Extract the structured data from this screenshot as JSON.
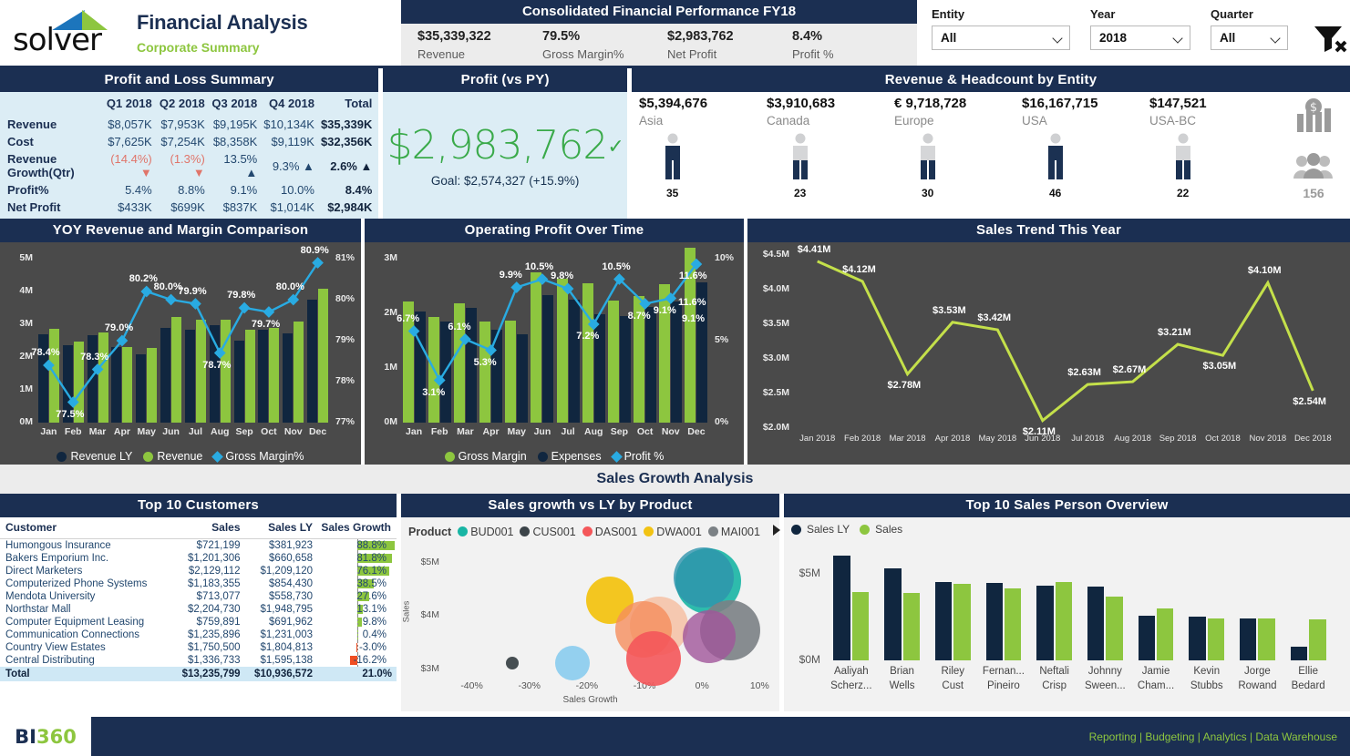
{
  "brand": {
    "logo_text": "solver",
    "title": "Financial Analysis",
    "subtitle": "Corporate Summary"
  },
  "header_kpi": {
    "title": "Consolidated Financial Performance FY18",
    "items": [
      {
        "value": "$35,339,322",
        "label": "Revenue"
      },
      {
        "value": "79.5%",
        "label": "Gross Margin%"
      },
      {
        "value": "$2,983,762",
        "label": "Net Profit"
      },
      {
        "value": "8.4%",
        "label": "Profit %"
      }
    ]
  },
  "filters": [
    {
      "label": "Entity",
      "value": "All"
    },
    {
      "label": "Year",
      "value": "2018"
    },
    {
      "label": "Quarter",
      "value": "All"
    }
  ],
  "filter_clear_icon": "clear-filter-icon",
  "pl": {
    "title": "Profit and Loss Summary",
    "columns": [
      "",
      "Q1 2018",
      "Q2 2018",
      "Q3 2018",
      "Q4 2018",
      "Total"
    ],
    "rows": [
      {
        "label": "Revenue",
        "cells": [
          "$8,057K",
          "$7,953K",
          "$9,195K",
          "$10,134K",
          "$35,339K"
        ]
      },
      {
        "label": "Cost",
        "cells": [
          "$7,625K",
          "$7,254K",
          "$8,358K",
          "$9,119K",
          "$32,356K"
        ]
      },
      {
        "label": "Revenue Growth(Qtr)",
        "cells": [
          "(14.4%)",
          "(1.3%)",
          "13.5%",
          "9.3%",
          "2.6%"
        ],
        "dirs": [
          "down",
          "down",
          "up",
          "up",
          "up"
        ]
      },
      {
        "label": "Profit%",
        "cells": [
          "5.4%",
          "8.8%",
          "9.1%",
          "10.0%",
          "8.4%"
        ]
      },
      {
        "label": "Net Profit",
        "cells": [
          "$433K",
          "$699K",
          "$837K",
          "$1,014K",
          "$2,984K"
        ]
      }
    ]
  },
  "profit_card": {
    "title": "Profit (vs PY)",
    "value": "$2,983,762",
    "check": "✓",
    "goal": "Goal: $2,574,327 (+15.9%)"
  },
  "entity_panel": {
    "title": "Revenue & Headcount by Entity",
    "entities": [
      {
        "revenue": "$5,394,676",
        "name": "Asia",
        "headcount": "35",
        "fill": "dark"
      },
      {
        "revenue": "$3,910,683",
        "name": "Canada",
        "headcount": "23",
        "fill": "light"
      },
      {
        "revenue": "€ 9,718,728",
        "name": "Europe",
        "headcount": "30",
        "fill": "half"
      },
      {
        "revenue": "$16,167,715",
        "name": "USA",
        "headcount": "46",
        "fill": "dark"
      },
      {
        "revenue": "$147,521",
        "name": "USA-BC",
        "headcount": "22",
        "fill": "light"
      }
    ],
    "money_icon": "money-bars-icon",
    "people_icon": "people-group-icon",
    "total_headcount": "156"
  },
  "chart_data": [
    {
      "id": "yoy",
      "type": "bar",
      "title": "YOY Revenue and Margin Comparison",
      "categories": [
        "Jan",
        "Feb",
        "Mar",
        "Apr",
        "May",
        "Jun",
        "Jul",
        "Aug",
        "Sep",
        "Oct",
        "Nov",
        "Dec"
      ],
      "series": [
        {
          "name": "Revenue LY",
          "color": "#10263f",
          "values": [
            2.7,
            2.37,
            2.66,
            2.3,
            2.08,
            2.9,
            2.83,
            2.97,
            2.51,
            2.82,
            2.72,
            3.75
          ]
        },
        {
          "name": "Revenue",
          "color": "#8dc63f",
          "values": [
            2.85,
            2.46,
            2.74,
            2.3,
            2.28,
            3.22,
            3.15,
            3.13,
            2.82,
            2.88,
            3.09,
            4.07
          ]
        }
      ],
      "line": {
        "name": "Gross Margin%",
        "color": "#29abe2",
        "values": [
          78.4,
          77.5,
          78.3,
          79.0,
          80.2,
          80.0,
          79.9,
          78.7,
          79.8,
          79.7,
          80.0,
          80.9
        ],
        "labels": [
          "78.4%",
          "77.5%",
          "78.3%",
          "79.0%",
          "80.2%",
          "80.0%",
          "79.9%",
          "78.7%",
          "79.8%",
          "79.7%",
          "80.0%",
          "80.9%"
        ]
      },
      "ylabel_ticks": [
        "5M",
        "4M",
        "3M",
        "2M",
        "1M",
        "0M"
      ],
      "ylim": [
        0,
        5
      ],
      "y2_ticks": [
        "81%",
        "80%",
        "79%",
        "78%",
        "77%"
      ],
      "y2lim": [
        77,
        81
      ],
      "legend": [
        "Revenue LY",
        "Revenue",
        "Gross Margin%"
      ],
      "legend_position": "bottom"
    },
    {
      "id": "opprofit",
      "type": "bar",
      "title": "Operating Profit Over Time",
      "categories": [
        "Jan",
        "Feb",
        "Mar",
        "Apr",
        "May",
        "Jun",
        "Jul",
        "Aug",
        "Sep",
        "Oct",
        "Nov",
        "Dec"
      ],
      "series": [
        {
          "name": "Gross Margin",
          "color": "#8dc63f",
          "values": [
            2.22,
            1.93,
            2.18,
            1.85,
            1.86,
            2.75,
            2.64,
            2.55,
            2.23,
            2.32,
            2.54,
            3.2
          ]
        },
        {
          "name": "Expenses",
          "color": "#10263f",
          "values": [
            2.03,
            1.85,
            2.1,
            1.7,
            1.61,
            2.33,
            2.25,
            1.98,
            1.95,
            2.11,
            2.22,
            2.57
          ]
        }
      ],
      "line": {
        "name": "Profit %",
        "color": "#29abe2",
        "values": [
          6.7,
          3.1,
          6.1,
          5.3,
          9.9,
          10.5,
          9.8,
          7.2,
          10.5,
          8.7,
          9.1,
          11.6
        ],
        "labels": [
          "6.7%",
          "3.1%",
          "6.1%",
          "5.3%",
          "9.9%",
          "10.5%",
          "9.8%",
          "7.2%",
          "10.5%",
          "8.7%",
          "9.1%",
          "11.6%"
        ]
      },
      "extra_labels": [
        "11.6%",
        "9.1%"
      ],
      "ylabel_ticks": [
        "3M",
        "2M",
        "1M",
        "0M"
      ],
      "ylim": [
        0,
        3
      ],
      "y2_ticks": [
        "10%",
        "5%",
        "0%"
      ],
      "y2lim": [
        0,
        12
      ],
      "legend": [
        "Gross Margin",
        "Expenses",
        "Profit %"
      ],
      "legend_position": "bottom"
    },
    {
      "id": "salestrend",
      "type": "line",
      "title": "Sales Trend This Year",
      "categories": [
        "Jan 2018",
        "Feb 2018",
        "Mar 2018",
        "Apr 2018",
        "May 2018",
        "Jun 2018",
        "Jul 2018",
        "Aug 2018",
        "Sep 2018",
        "Oct 2018",
        "Nov 2018",
        "Dec 2018"
      ],
      "values": [
        4.41,
        4.12,
        2.78,
        3.53,
        3.42,
        2.11,
        2.63,
        2.67,
        3.21,
        3.05,
        4.1,
        2.54
      ],
      "labels": [
        "$4.41M",
        "$4.12M",
        "$2.78M",
        "$3.53M",
        "$3.42M",
        "$2.11M",
        "$2.63M",
        "$2.67M",
        "$3.21M",
        "$3.05M",
        "$4.10M",
        "$2.54M"
      ],
      "color": "#c4e04a",
      "ylabel_ticks": [
        "$4.5M",
        "$4.0M",
        "$3.5M",
        "$3.0M",
        "$2.5M",
        "$2.0M"
      ],
      "ylim": [
        2.0,
        4.5
      ],
      "xlabel": "",
      "ylabel": ""
    },
    {
      "id": "scatter",
      "type": "scatter",
      "title": "Sales growth vs LY by Product",
      "legend_label": "Product",
      "legend": [
        {
          "name": "BUD001",
          "color": "#18b5a4"
        },
        {
          "name": "CUS001",
          "color": "#3c4449"
        },
        {
          "name": "DAS001",
          "color": "#f4575a"
        },
        {
          "name": "DWA001",
          "color": "#f2c314"
        },
        {
          "name": "MAI001",
          "color": "#7b8185"
        }
      ],
      "xlabel": "Sales Growth",
      "ylabel": "Sales",
      "xticks": [
        "-40%",
        "-30%",
        "-20%",
        "-10%",
        "0%",
        "10%"
      ],
      "yticks": [
        "$5M",
        "$4M",
        "$3M"
      ],
      "xlim": [
        -45,
        12
      ],
      "ylim": [
        2.9,
        5.2
      ],
      "points": [
        {
          "product": "CUS001",
          "x": -33.0,
          "y": 3.12,
          "r": 7,
          "color": "#3c4449",
          "opacity": 0.95
        },
        {
          "product": "P-blue",
          "x": -22.5,
          "y": 3.13,
          "r": 19,
          "color": "#8ecdee",
          "opacity": 0.95
        },
        {
          "product": "DWA001",
          "x": -16.0,
          "y": 4.3,
          "r": 26,
          "color": "#f2c314",
          "opacity": 0.95
        },
        {
          "product": "P-peach",
          "x": -7.5,
          "y": 3.82,
          "r": 32,
          "color": "#f5b99a",
          "opacity": 0.75
        },
        {
          "product": "P-orange",
          "x": -10.2,
          "y": 3.75,
          "r": 31,
          "color": "#f58d5d",
          "opacity": 0.8
        },
        {
          "product": "DAS001",
          "x": -8.5,
          "y": 3.2,
          "r": 30,
          "color": "#f4575a",
          "opacity": 0.9
        },
        {
          "product": "BUD001",
          "x": 1.0,
          "y": 4.65,
          "r": 36,
          "color": "#18b5a4",
          "opacity": 0.9
        },
        {
          "product": "P-teal",
          "x": 0.3,
          "y": 4.72,
          "r": 33,
          "color": "#2e93ad",
          "opacity": 0.8
        },
        {
          "product": "MAI001",
          "x": 4.8,
          "y": 3.74,
          "r": 33,
          "color": "#7b8185",
          "opacity": 0.9
        },
        {
          "product": "P-purple",
          "x": 1.2,
          "y": 3.62,
          "r": 29,
          "color": "#a0559a",
          "opacity": 0.8
        }
      ]
    },
    {
      "id": "salesperson",
      "type": "bar",
      "title": "Top 10 Sales Person Overview",
      "categories": [
        "Aaliyah Scherz...",
        "Brian Wells",
        "Riley Cust",
        "Fernan... Pineiro",
        "Neftali Crisp",
        "Johnny Sween...",
        "Jamie Cham...",
        "Kevin Stubbs",
        "Jorge Rowand",
        "Ellie Bedard"
      ],
      "categories_l1": [
        "Aaliyah",
        "Brian",
        "Riley",
        "Fernan...",
        "Neftali",
        "Johnny",
        "Jamie",
        "Kevin",
        "Jorge",
        "Ellie"
      ],
      "categories_l2": [
        "Scherz...",
        "Wells",
        "Cust",
        "Pineiro",
        "Crisp",
        "Sween...",
        "Cham...",
        "Stubbs",
        "Rowand",
        "Bedard"
      ],
      "series": [
        {
          "name": "Sales LY",
          "color": "#10263f",
          "values": [
            6.1,
            5.33,
            4.55,
            4.5,
            4.32,
            4.26,
            2.6,
            2.55,
            2.42,
            0.78
          ]
        },
        {
          "name": "Sales",
          "color": "#8dc63f",
          "values": [
            3.95,
            3.9,
            4.45,
            4.18,
            4.55,
            3.72,
            3.0,
            2.45,
            2.45,
            2.4
          ]
        }
      ],
      "yticks": [
        "$5M",
        "$0M"
      ],
      "ylim": [
        0,
        6.5
      ],
      "legend": [
        "Sales LY",
        "Sales"
      ],
      "legend_position": "top-left"
    }
  ],
  "section_band": {
    "title": "Sales Growth Analysis"
  },
  "customers": {
    "title": "Top 10 Customers",
    "columns": [
      "Customer",
      "Sales",
      "Sales LY",
      "Sales Growth"
    ],
    "sort_icon": "sort-desc-icon",
    "rows": [
      {
        "customer": "Humongous Insurance",
        "sales": "$721,199",
        "sales_ly": "$381,923",
        "growth": "88.8%",
        "growth_val": 88.8
      },
      {
        "customer": "Bakers Emporium Inc.",
        "sales": "$1,201,306",
        "sales_ly": "$660,658",
        "growth": "81.8%",
        "growth_val": 81.8
      },
      {
        "customer": "Direct Marketers",
        "sales": "$2,129,112",
        "sales_ly": "$1,209,120",
        "growth": "76.1%",
        "growth_val": 76.1
      },
      {
        "customer": "Computerized Phone Systems",
        "sales": "$1,183,355",
        "sales_ly": "$854,430",
        "growth": "38.5%",
        "growth_val": 38.5
      },
      {
        "customer": "Mendota University",
        "sales": "$713,077",
        "sales_ly": "$558,730",
        "growth": "27.6%",
        "growth_val": 27.6
      },
      {
        "customer": "Northstar Mall",
        "sales": "$2,204,730",
        "sales_ly": "$1,948,795",
        "growth": "13.1%",
        "growth_val": 13.1
      },
      {
        "customer": "Computer Equipment Leasing",
        "sales": "$759,891",
        "sales_ly": "$691,962",
        "growth": "9.8%",
        "growth_val": 9.8
      },
      {
        "customer": "Communication Connections",
        "sales": "$1,235,896",
        "sales_ly": "$1,231,003",
        "growth": "0.4%",
        "growth_val": 0.4
      },
      {
        "customer": "Country View Estates",
        "sales": "$1,750,500",
        "sales_ly": "$1,804,813",
        "growth": "-3.0%",
        "growth_val": -3.0
      },
      {
        "customer": "Central Distributing",
        "sales": "$1,336,733",
        "sales_ly": "$1,595,138",
        "growth": "-16.2%",
        "growth_val": -16.2
      }
    ],
    "total": {
      "customer": "Total",
      "sales": "$13,235,799",
      "sales_ly": "$10,936,572",
      "growth": "21.0%"
    }
  },
  "footer": {
    "logo": "BI360",
    "links": "Reporting | Budgeting | Analytics | Data Warehouse"
  }
}
